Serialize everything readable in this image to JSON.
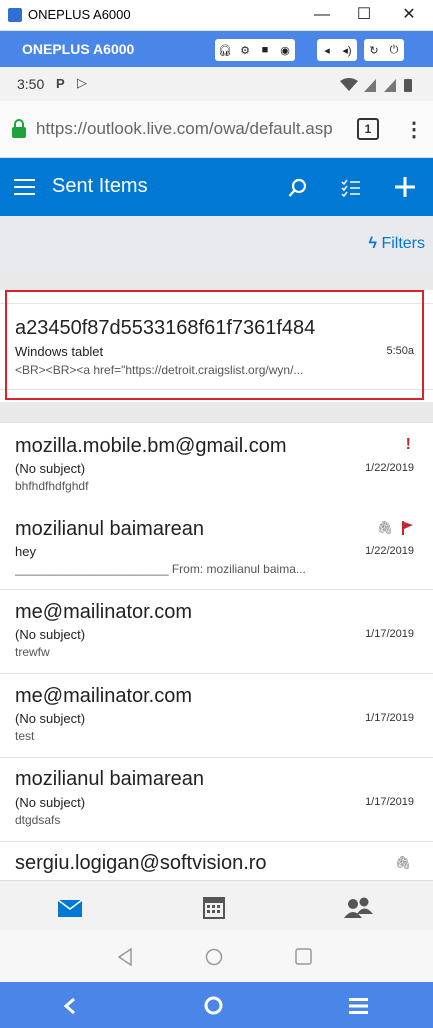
{
  "window": {
    "title": "ONEPLUS A6000",
    "minimize": "—",
    "maximize": "☐",
    "close": "✕"
  },
  "emulator": {
    "device_name": "ONEPLUS A6000"
  },
  "status": {
    "time": "3:50"
  },
  "browser": {
    "url": "https://outlook.live.com/owa/default.asp",
    "tab_count": "1"
  },
  "header": {
    "title": "Sent Items"
  },
  "filters": {
    "label": "Filters"
  },
  "messages": [
    {
      "sender": "a23450f87d5533168f61f7361f484",
      "subject": "Windows tablet",
      "date": "5:50a",
      "preview": "<BR><BR><a href=\"https://detroit.craigslist.org/wyn/..."
    },
    {
      "sender": "mozilla.mobile.bm@gmail.com",
      "subject": "(No subject)",
      "date": "1/22/2019",
      "preview": "bhfhdfhdfghdf"
    },
    {
      "sender": "mozilianul baimarean",
      "subject": "hey",
      "date": "1/22/2019",
      "preview": "_______________________ From: mozilianul baima..."
    },
    {
      "sender": "me@mailinator.com",
      "subject": "(No subject)",
      "date": "1/17/2019",
      "preview": "trewfw"
    },
    {
      "sender": "me@mailinator.com",
      "subject": "(No subject)",
      "date": "1/17/2019",
      "preview": "test"
    },
    {
      "sender": "mozilianul baimarean",
      "subject": "(No subject)",
      "date": "1/17/2019",
      "preview": "dtgdsafs"
    },
    {
      "sender": "sergiu.logigan@softvision.ro"
    }
  ],
  "colors": {
    "accent": "#0078d4",
    "emulator": "#4a86e8",
    "highlight": "#d9232b",
    "flag": "#c4262e"
  }
}
